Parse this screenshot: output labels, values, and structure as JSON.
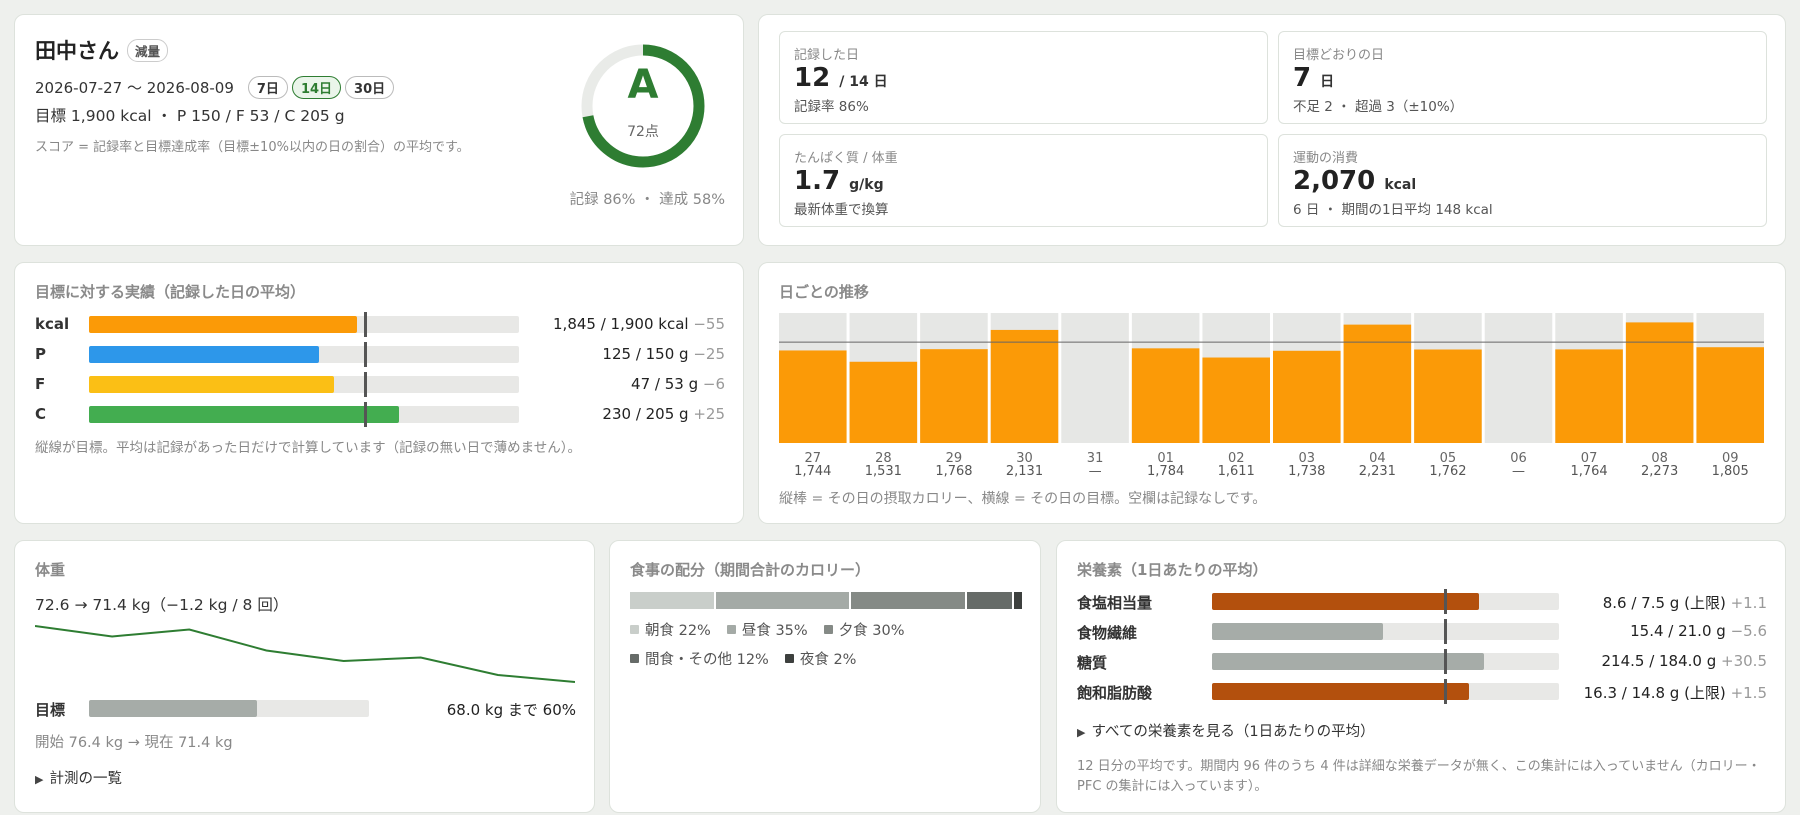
{
  "header": {
    "name": "田中さん",
    "mode_badge": "減量",
    "date_range": "2026-07-27 〜 2026-08-09",
    "range_tabs": [
      "7日",
      "14日",
      "30日"
    ],
    "active_range_index": 1,
    "targets": "目標 1,900 kcal ・ P 150 / F 53 / C 205 g",
    "score_note": "スコア = 記録率と目標達成率（目標±10%以内の日の割合）の平均です。",
    "grade": "A",
    "points": "72点",
    "score_ratio": 0.72,
    "score_summary": "記録 86% ・ 達成 58%"
  },
  "stats": [
    {
      "label": "記録した日",
      "value": "12",
      "unit": "/ 14 日",
      "sub": "記録率 86%"
    },
    {
      "label": "目標どおりの日",
      "value": "7",
      "unit": "日",
      "sub": "不足 2 ・ 超過 3（±10%）"
    },
    {
      "label": "たんぱく質 / 体重",
      "value": "1.7",
      "unit": "g/kg",
      "sub": "最新体重で換算"
    },
    {
      "label": "運動の消費",
      "value": "2,070",
      "unit": "kcal",
      "sub": "6 日 ・ 期間の1日平均 148 kcal"
    }
  ],
  "macros": {
    "title": "目標に対する実績（記録した日の平均）",
    "rows": [
      {
        "label": "kcal",
        "ratio": 0.971,
        "color": "#fb9a07",
        "value": "1,845 / 1,900 kcal",
        "diff": "−55"
      },
      {
        "label": "P",
        "ratio": 0.833,
        "color": "#2d97ea",
        "value": "125 / 150 g",
        "diff": "−25"
      },
      {
        "label": "F",
        "ratio": 0.887,
        "color": "#fbbf15",
        "value": "47 / 53 g",
        "diff": "−6"
      },
      {
        "label": "C",
        "ratio": 1.122,
        "color": "#43ad50",
        "value": "230 / 205 g",
        "diff": "+25"
      }
    ],
    "note": "縦線が目標。平均は記録があった日だけで計算しています（記録の無い日で薄めません）。"
  },
  "chart_data": {
    "type": "bar",
    "title": "日ごとの推移",
    "categories": [
      "27",
      "28",
      "29",
      "30",
      "31",
      "01",
      "02",
      "03",
      "04",
      "05",
      "06",
      "07",
      "08",
      "09"
    ],
    "value_labels": [
      "1,744",
      "1,531",
      "1,768",
      "2,131",
      "—",
      "1,784",
      "1,611",
      "1,738",
      "2,231",
      "1,762",
      "—",
      "1,764",
      "2,273",
      "1,805"
    ],
    "values": [
      1744,
      1531,
      1768,
      2131,
      null,
      1784,
      1611,
      1738,
      2231,
      1762,
      null,
      1764,
      2273,
      1805
    ],
    "target": 1900,
    "ylim": [
      0,
      2450
    ],
    "bar_color": "#fb9a07",
    "note": "縦棒 = その日の摂取カロリー、横線 = その日の目標。空欄は記録なしです。"
  },
  "weight": {
    "title": "体重",
    "summary": "72.6 → 71.4 kg（−1.2 kg / 8 回）",
    "points": [
      72.6,
      72.3,
      72.5,
      71.9,
      71.6,
      71.7,
      71.2,
      71.0
    ],
    "goal_label": "目標",
    "goal_ratio": 0.6,
    "goal_text": "68.0 kg まで 60%",
    "progress_text": "開始 76.4 kg → 現在 71.4 kg",
    "list_toggle": "計測の一覧"
  },
  "meals": {
    "title": "食事の配分（期間合計のカロリー）",
    "segments": [
      {
        "label": "朝食 22%",
        "pct": 22,
        "color": "#c9ceca"
      },
      {
        "label": "昼食 35%",
        "pct": 35,
        "color": "#a4aaa6"
      },
      {
        "label": "夕食 30%",
        "pct": 30,
        "color": "#858a86"
      },
      {
        "label": "間食・その他 12%",
        "pct": 12,
        "color": "#666b68"
      },
      {
        "label": "夜食 2%",
        "pct": 2,
        "color": "#3d403e"
      }
    ]
  },
  "nutrients": {
    "title": "栄養素（1日あたりの平均）",
    "rows": [
      {
        "label": "食塩相当量",
        "ratio": 1.147,
        "color": "#b3500d",
        "value": "8.6 / 7.5 g (上限)",
        "diff": "+1.1"
      },
      {
        "label": "食物繊維",
        "ratio": 0.733,
        "color": "#a6aca8",
        "value": "15.4 / 21.0 g",
        "diff": "−5.6"
      },
      {
        "label": "糖質",
        "ratio": 1.166,
        "color": "#a6aca8",
        "value": "214.5 / 184.0 g",
        "diff": "+30.5"
      },
      {
        "label": "飽和脂肪酸",
        "ratio": 1.101,
        "color": "#b3500d",
        "value": "16.3 / 14.8 g (上限)",
        "diff": "+1.5"
      }
    ],
    "see_all": "すべての栄養素を見る（1日あたりの平均）",
    "note": "12 日分の平均です。期間内 96 件のうち 4 件は詳細な栄養データが無く、この集計には入っていません（カロリー・PFC の集計には入っています）。"
  }
}
